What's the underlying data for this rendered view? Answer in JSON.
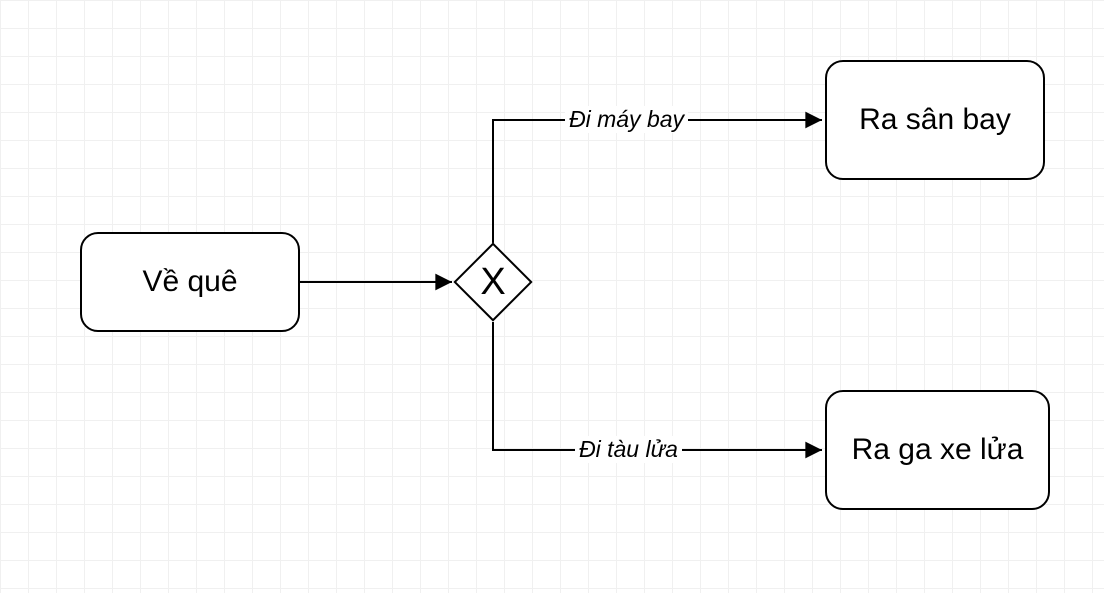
{
  "diagram": {
    "nodes": {
      "start": {
        "label": "Về quê"
      },
      "gateway": {
        "marker": "X"
      },
      "airport": {
        "label": "Ra sân bay"
      },
      "train": {
        "label": "Ra ga xe lửa"
      }
    },
    "edges": {
      "to_airport": {
        "label": "Đi máy bay"
      },
      "to_train": {
        "label": "Đi tàu lửa"
      }
    }
  }
}
